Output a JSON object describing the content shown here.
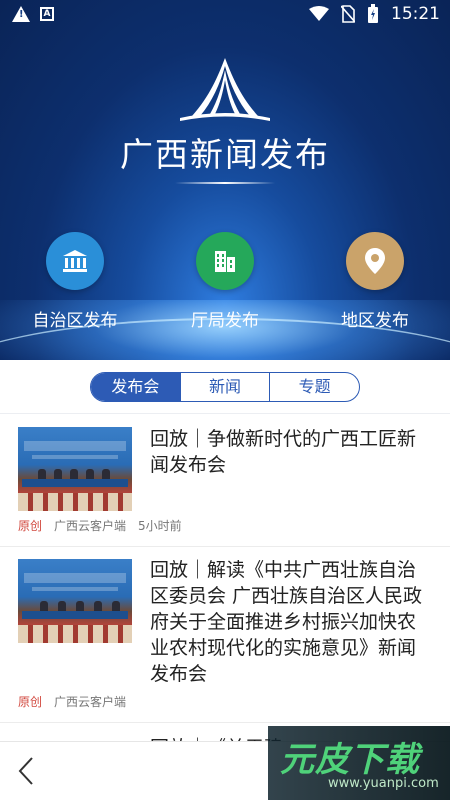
{
  "status_bar": {
    "time": "15:21",
    "a_icon": "A"
  },
  "header": {
    "title": "广西新闻发布",
    "categories": [
      {
        "label": "自治区发布",
        "icon": "building-icon",
        "color": "#2a8fd8"
      },
      {
        "label": "厅局发布",
        "icon": "office-building-icon",
        "color": "#25a85a"
      },
      {
        "label": "地区发布",
        "icon": "location-pin-icon",
        "color": "#caa36a"
      }
    ]
  },
  "tabs": [
    {
      "label": "发布会",
      "active": true
    },
    {
      "label": "新闻",
      "active": false
    },
    {
      "label": "专题",
      "active": false
    }
  ],
  "news": [
    {
      "title": "回放｜争做新时代的广西工匠新闻发布会",
      "tag": "原创",
      "source": "广西云客户端",
      "time": "5小时前",
      "thumb_banner": "广西壮族自治区人民政府新闻办公室"
    },
    {
      "title": "回放｜解读《中共广西壮族自治区委员会 广西壮族自治区人民政府关于全面推进乡村振兴加快农业农村现代化的实施意见》新闻发布会",
      "tag": "原创",
      "source": "广西云客户端",
      "time": "",
      "thumb_banner": "广西壮族自治区人民政府新闻办公室"
    },
    {
      "title": "回放｜《关于建...",
      "tag": "",
      "source": "",
      "time": ""
    }
  ],
  "watermark": {
    "text": "元皮下载",
    "url": "www.yuanpi.com"
  }
}
